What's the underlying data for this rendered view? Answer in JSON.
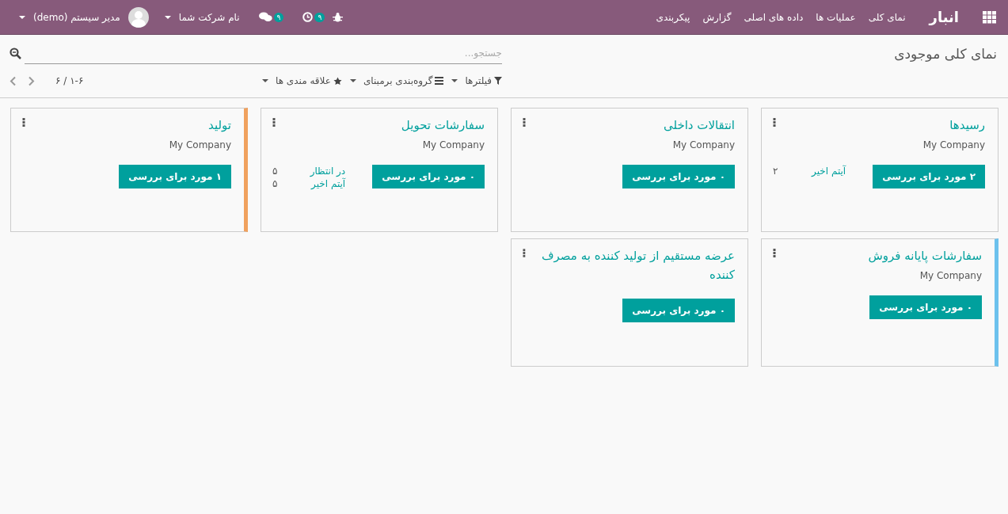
{
  "navbar": {
    "app_name": "انبار",
    "menu": [
      "نمای کلی",
      "عملیات ها",
      "داده های اصلی",
      "گزارش",
      "پیکربندی"
    ],
    "systray": {
      "activity_count": "۹",
      "messages_count": "۹",
      "company": "نام شرکت شما",
      "user": "مدیر سیستم (demo)"
    }
  },
  "control_panel": {
    "title": "نمای کلی موجودی",
    "search": {
      "placeholder": "جستجو..."
    },
    "filters": [
      "فیلترها",
      "گروه‌بندی برمبنای",
      "علاقه مندی ها"
    ],
    "pager": "۱-۶ / ۶"
  },
  "cards": [
    {
      "title": "رسیدها",
      "company": "My Company",
      "button": "۲ مورد برای بررسی",
      "stats": [
        {
          "label": "آیتم اخیر",
          "value": "۲"
        }
      ]
    },
    {
      "title": "انتقالات داخلی",
      "company": "My Company",
      "button": "۰ مورد برای بررسی"
    },
    {
      "title": "سفارشات تحویل",
      "company": "My Company",
      "button": "۰ مورد برای بررسی",
      "stats": [
        {
          "label": "در انتظار",
          "value": "۵"
        },
        {
          "label": "آیتم اخیر",
          "value": "۵"
        }
      ]
    },
    {
      "title": "تولید",
      "company": "My Company",
      "button": "۱ مورد برای بررسی",
      "color": "#f0a15e"
    },
    {
      "title": "سفارشات پایانه فروش",
      "company": "My Company",
      "button": "۰ مورد برای بررسی",
      "color": "#6cc1ed"
    },
    {
      "title": "عرضه مستقیم از تولید کننده به مصرف کننده",
      "button": "۰ مورد برای بررسی"
    }
  ]
}
